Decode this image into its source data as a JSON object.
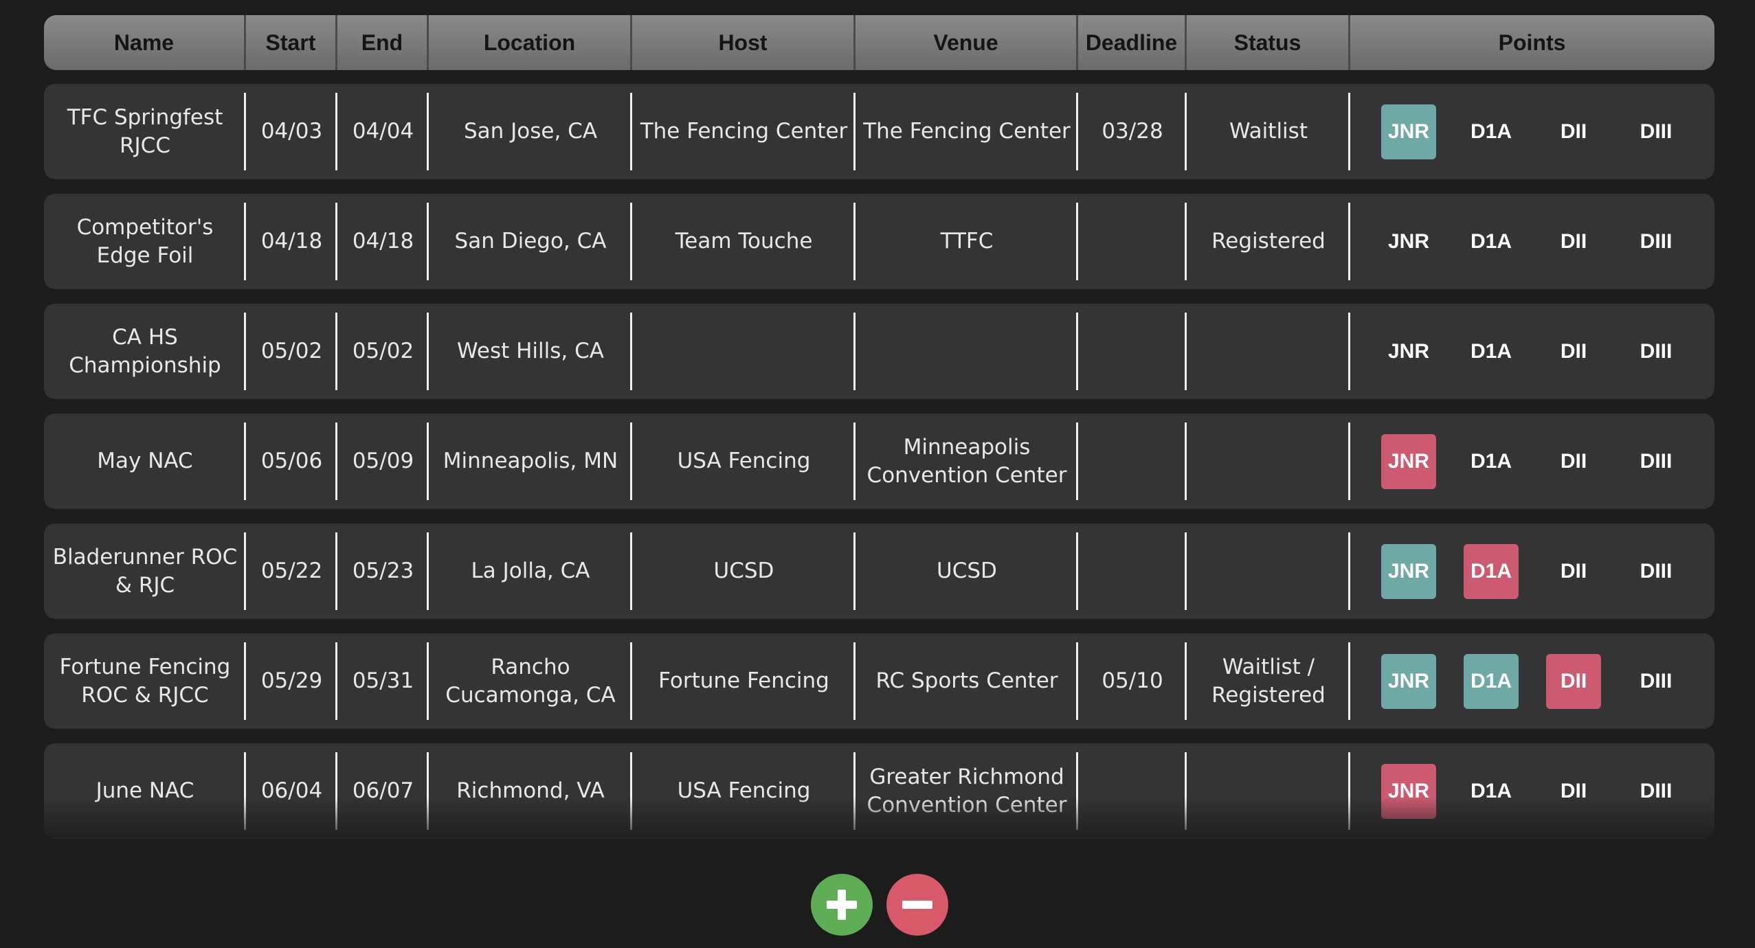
{
  "table": {
    "headers": [
      "Name",
      "Start",
      "End",
      "Location",
      "Host",
      "Venue",
      "Deadline",
      "Status",
      "Points"
    ],
    "rows": [
      {
        "name": "TFC Springfest RJCC",
        "start": "04/03",
        "end": "04/04",
        "location": "San Jose, CA",
        "host": "The Fencing Center",
        "venue": "The Fencing Center",
        "deadline": "03/28",
        "status": "Waitlist",
        "points": [
          {
            "label": "JNR",
            "state": "teal"
          },
          {
            "label": "D1A",
            "state": "none"
          },
          {
            "label": "DII",
            "state": "none"
          },
          {
            "label": "DIII",
            "state": "none"
          }
        ]
      },
      {
        "name": "Competitor's Edge Foil",
        "start": "04/18",
        "end": "04/18",
        "location": "San Diego, CA",
        "host": "Team Touche",
        "venue": "TTFC",
        "deadline": "",
        "status": "Registered",
        "points": [
          {
            "label": "JNR",
            "state": "none"
          },
          {
            "label": "D1A",
            "state": "none"
          },
          {
            "label": "DII",
            "state": "none"
          },
          {
            "label": "DIII",
            "state": "none"
          }
        ]
      },
      {
        "name": "CA HS Championship",
        "start": "05/02",
        "end": "05/02",
        "location": "West Hills, CA",
        "host": "",
        "venue": "",
        "deadline": "",
        "status": "",
        "points": [
          {
            "label": "JNR",
            "state": "none"
          },
          {
            "label": "D1A",
            "state": "none"
          },
          {
            "label": "DII",
            "state": "none"
          },
          {
            "label": "DIII",
            "state": "none"
          }
        ]
      },
      {
        "name": "May NAC",
        "start": "05/06",
        "end": "05/09",
        "location": "Minneapolis, MN",
        "host": "USA Fencing",
        "venue": "Minneapolis Convention Center",
        "deadline": "",
        "status": "",
        "points": [
          {
            "label": "JNR",
            "state": "red"
          },
          {
            "label": "D1A",
            "state": "none"
          },
          {
            "label": "DII",
            "state": "none"
          },
          {
            "label": "DIII",
            "state": "none"
          }
        ]
      },
      {
        "name": "Bladerunner ROC & RJC",
        "start": "05/22",
        "end": "05/23",
        "location": "La Jolla, CA",
        "host": "UCSD",
        "venue": "UCSD",
        "deadline": "",
        "status": "",
        "points": [
          {
            "label": "JNR",
            "state": "teal"
          },
          {
            "label": "D1A",
            "state": "red"
          },
          {
            "label": "DII",
            "state": "none"
          },
          {
            "label": "DIII",
            "state": "none"
          }
        ]
      },
      {
        "name": "Fortune Fencing ROC & RJCC",
        "start": "05/29",
        "end": "05/31",
        "location": "Rancho Cucamonga, CA",
        "host": "Fortune Fencing",
        "venue": "RC Sports Center",
        "deadline": "05/10",
        "status": "Waitlist / Registered",
        "points": [
          {
            "label": "JNR",
            "state": "teal"
          },
          {
            "label": "D1A",
            "state": "teal"
          },
          {
            "label": "DII",
            "state": "red"
          },
          {
            "label": "DIII",
            "state": "none"
          }
        ]
      },
      {
        "name": "June NAC",
        "start": "06/04",
        "end": "06/07",
        "location": "Richmond, VA",
        "host": "USA Fencing",
        "venue": "Greater Richmond Convention Center",
        "deadline": "",
        "status": "",
        "points": [
          {
            "label": "JNR",
            "state": "red"
          },
          {
            "label": "D1A",
            "state": "none"
          },
          {
            "label": "DII",
            "state": "none"
          },
          {
            "label": "DIII",
            "state": "none"
          }
        ]
      }
    ]
  },
  "actions": {
    "add_icon": "plus-icon",
    "remove_icon": "minus-icon"
  },
  "colors": {
    "teal": "#6fa9a5",
    "red": "#cc5b71",
    "add": "#5fae56",
    "remove": "#d85a6a"
  }
}
